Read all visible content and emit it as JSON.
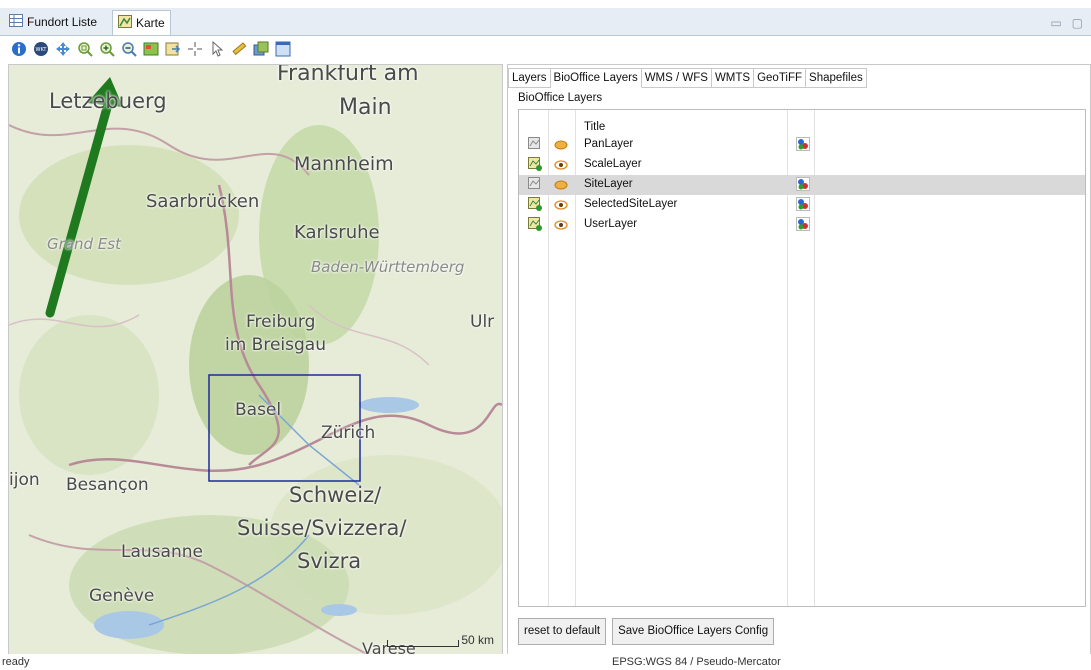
{
  "tabs": {
    "fundort": "Fundort Liste",
    "karte": "Karte"
  },
  "toolbar": {
    "icons": [
      "info-icon",
      "wkt-icon",
      "pan-icon",
      "zoom-extent-icon",
      "zoom-in-icon",
      "zoom-out-icon",
      "zoom-layer-icon",
      "export-icon",
      "crosshair-icon",
      "select-pointer-icon",
      "measure-icon",
      "layers-icon",
      "window-icon"
    ],
    "wkt_label": "WKT"
  },
  "map": {
    "labels": {
      "frankfurt": "Frankfurt am",
      "main": "Main",
      "luxembourg": "Letzebuerg",
      "mannheim": "Mannheim",
      "saarbrucken": "Saarbrücken",
      "karlsruhe": "Karlsruhe",
      "grandest": "Grand Est",
      "bw": "Baden-Württemberg",
      "freiburg1": "Freiburg",
      "freiburg2": "im Breisgau",
      "ulm": "Ulr",
      "basel": "Basel",
      "zurich": "Zürich",
      "dijon": "ijon",
      "besancon": "Besançon",
      "schweiz1": "Schweiz/",
      "schweiz2": "Suisse/Svizzera/",
      "schweiz3": "Svizra",
      "lausanne": "Lausanne",
      "geneve": "Genève",
      "varese": "Varese"
    },
    "scale": "50 km",
    "arrow_color": "#1f7a1f",
    "selection_color": "#1a2b9b"
  },
  "panel": {
    "tabs": [
      "Layers",
      "BioOffice Layers",
      "WMS / WFS",
      "WMTS",
      "GeoTiFF",
      "Shapefiles"
    ],
    "active_tab": "BioOffice Layers",
    "group_title": "BioOffice Layers",
    "column_title": "Title",
    "layers": [
      {
        "name": "PanLayer",
        "visible": false,
        "style_icon": true,
        "selected": false
      },
      {
        "name": "ScaleLayer",
        "visible": true,
        "style_icon": false,
        "selected": false
      },
      {
        "name": "SiteLayer",
        "visible": false,
        "style_icon": true,
        "selected": true
      },
      {
        "name": "SelectedSiteLayer",
        "visible": true,
        "style_icon": true,
        "selected": false
      },
      {
        "name": "UserLayer",
        "visible": true,
        "style_icon": true,
        "selected": false
      }
    ],
    "reset_label": "reset to default",
    "save_label": "Save BioOffice Layers Config"
  },
  "status": {
    "left": "ready",
    "right": "EPSG:WGS 84 / Pseudo-Mercator"
  }
}
